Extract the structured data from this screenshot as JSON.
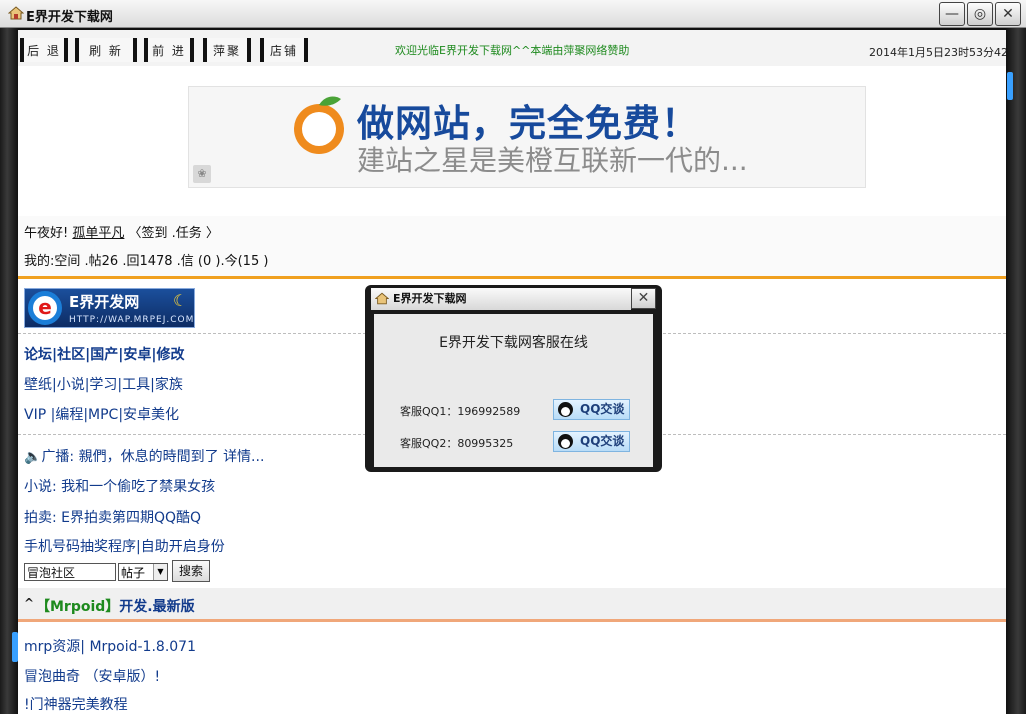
{
  "window": {
    "title": "E界开发下载网",
    "controls": [
      "—",
      "◎",
      "✕"
    ]
  },
  "toolbar": {
    "buttons": [
      "后 退",
      "刷 新",
      "前 进",
      "萍聚",
      "店铺"
    ],
    "welcome": "欢迎光临E界开发下载网^^本端由萍聚网络赞助",
    "datetime": "2014年1月5日23时53分42秒"
  },
  "banner": {
    "headline": "做网站，完全免费！",
    "sub": "建站之星是美橙互联新一代的..."
  },
  "user": {
    "greeting": "午夜好!",
    "username": "孤单平凡",
    "actions": "〈签到 .任务 〉",
    "stats": "我的:空间 .帖26 .回1478 .信 (0 ).今(15 )"
  },
  "logo": {
    "text": "E界开发网",
    "url": "HTTP://WAP.MRPEJ.COM"
  },
  "nav": {
    "main": "论坛|社区|国产|安卓|修改",
    "row2": "壁纸|小说|学习|工具|家族",
    "row3": "VIP |编程|MPC|安卓美化"
  },
  "broadcast": {
    "label": "广播:",
    "text": "親們，休息的時間到了",
    "more": "详情..."
  },
  "links": {
    "novel": "小说: 我和一个偷吃了禁果女孩",
    "auction": "拍卖: E界拍卖第四期QQ酷Q",
    "lottery": "手机号码抽奖程序|自助开启身份"
  },
  "search": {
    "value": "冒泡社区",
    "select": "帖子",
    "button": "搜索"
  },
  "section": {
    "chevron": "^",
    "bracket_open": "【",
    "brand": "Mrpoid",
    "bracket_close": "】",
    "title": "开发.最新版",
    "links": [
      "mrp资源| Mrpoid-1.8.071",
      "冒泡曲奇 （安卓版）!",
      "!门神器完美教程"
    ]
  },
  "popup": {
    "title": "E界开发下载网",
    "close": "✕",
    "heading": "E界开发下载网客服在线",
    "qq1_label": "客服QQ1：196992589",
    "qq2_label": "客服QQ2：80995325",
    "qq_button": "QQ交谈"
  }
}
